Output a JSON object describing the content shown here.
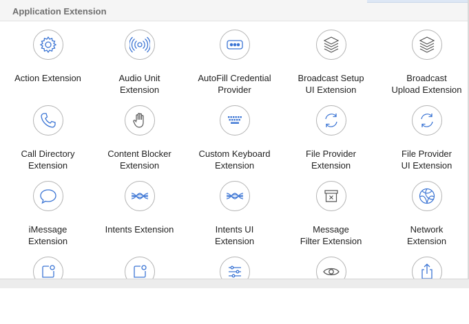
{
  "section": {
    "title": "Application Extension"
  },
  "accent": "#3a74d4",
  "templates": [
    {
      "icon": "gear-icon",
      "line1": "Action Extension",
      "line2": ""
    },
    {
      "icon": "audio-wave-icon",
      "line1": "Audio Unit",
      "line2": "Extension"
    },
    {
      "icon": "password-dots-icon",
      "line1": "AutoFill Credential",
      "line2": "Provider"
    },
    {
      "icon": "stack-icon",
      "line1": "Broadcast Setup",
      "line2": "UI Extension"
    },
    {
      "icon": "stack-icon",
      "line1": "Broadcast",
      "line2": "Upload Extension"
    },
    {
      "icon": "phone-icon",
      "line1": "Call Directory",
      "line2": "Extension"
    },
    {
      "icon": "hand-icon",
      "line1": "Content Blocker",
      "line2": "Extension"
    },
    {
      "icon": "keyboard-icon",
      "line1": "Custom Keyboard",
      "line2": "Extension"
    },
    {
      "icon": "sync-icon",
      "line1": "File Provider",
      "line2": "Extension"
    },
    {
      "icon": "sync-icon",
      "line1": "File Provider",
      "line2": "UI Extension"
    },
    {
      "icon": "speech-bubble-icon",
      "line1": "iMessage",
      "line2": "Extension"
    },
    {
      "icon": "intents-wave-icon",
      "line1": "Intents Extension",
      "line2": ""
    },
    {
      "icon": "intents-wave-icon",
      "line1": "Intents UI",
      "line2": "Extension"
    },
    {
      "icon": "filter-box-icon",
      "line1": "Message",
      "line2": "Filter Extension"
    },
    {
      "icon": "globe-icon",
      "line1": "Network",
      "line2": "Extension"
    },
    {
      "icon": "notification-icon",
      "line1": "",
      "line2": ""
    },
    {
      "icon": "notification-icon",
      "line1": "",
      "line2": ""
    },
    {
      "icon": "sliders-icon",
      "line1": "",
      "line2": ""
    },
    {
      "icon": "eye-icon",
      "line1": "",
      "line2": ""
    },
    {
      "icon": "share-icon",
      "line1": "",
      "line2": ""
    }
  ]
}
